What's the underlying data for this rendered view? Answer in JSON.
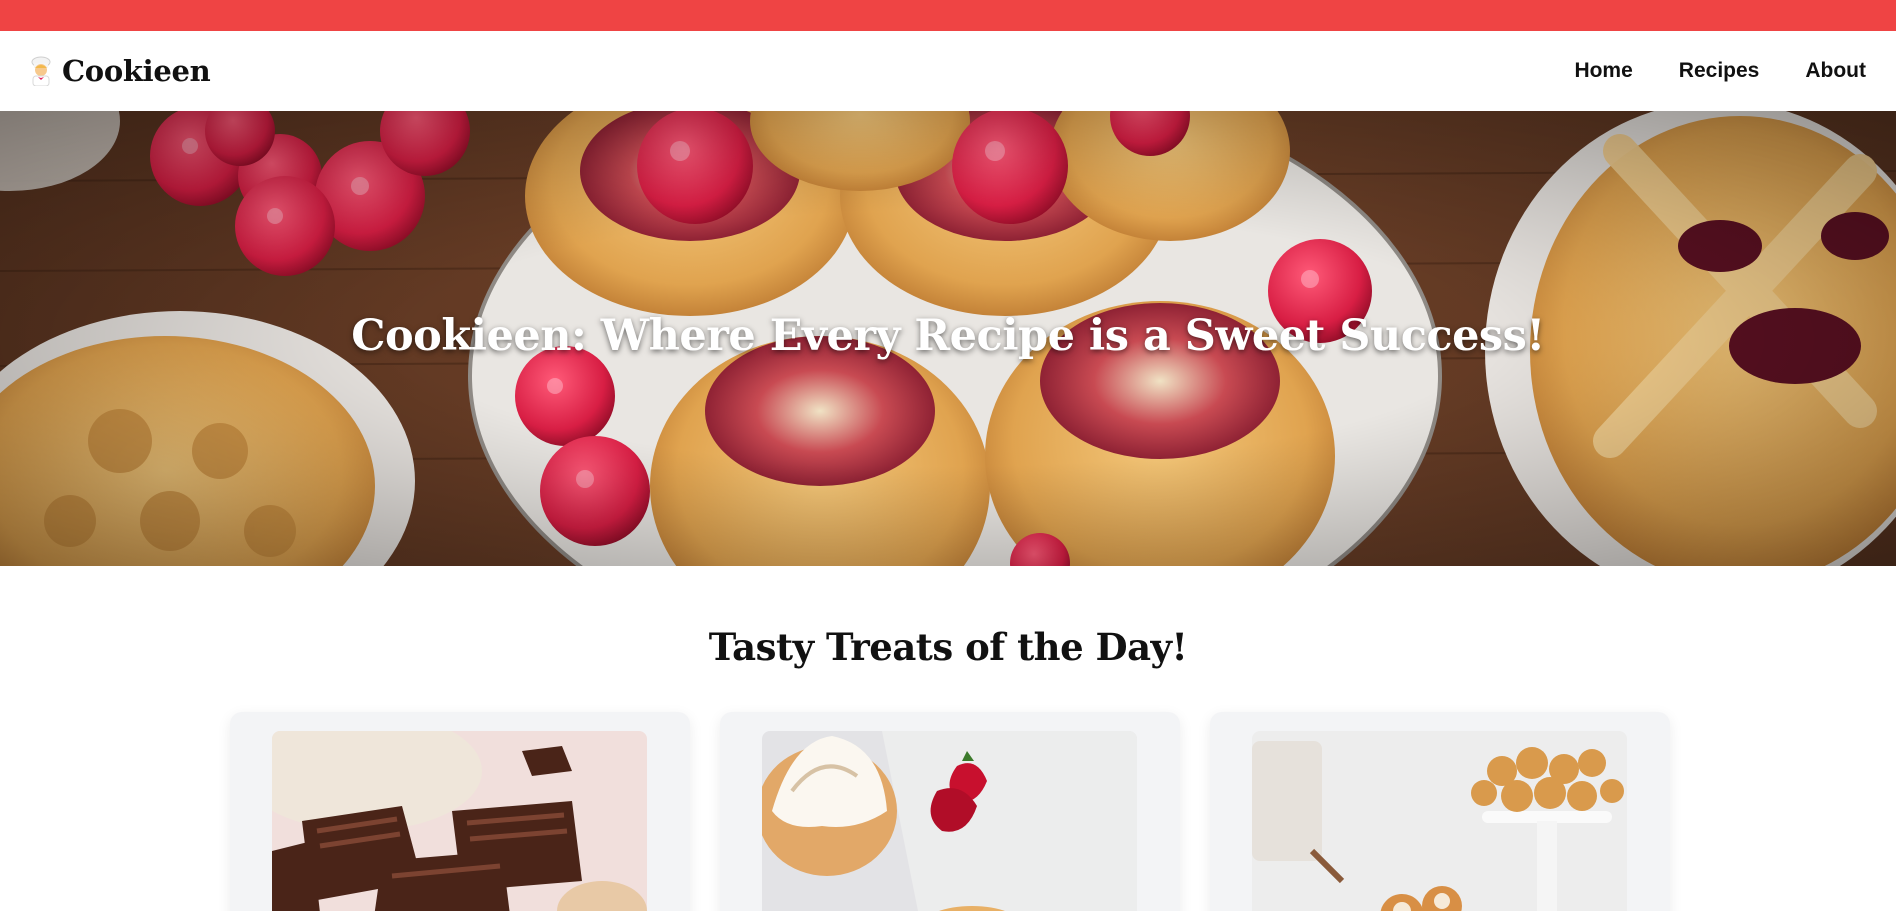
{
  "brand": {
    "name": "Cookieen",
    "icon": "chef-emoji-icon"
  },
  "nav": {
    "items": [
      {
        "label": "Home"
      },
      {
        "label": "Recipes"
      },
      {
        "label": "About"
      }
    ]
  },
  "hero": {
    "title": "Cookieen: Where Every Recipe is a Sweet Success!"
  },
  "section": {
    "title": "Tasty Treats of the Day!"
  },
  "colors": {
    "accent_bar": "#ef4444",
    "card_bg": "#f3f4f6"
  },
  "cards": [
    {
      "image": "chocolate-brownies-image"
    },
    {
      "image": "meringue-tart-strawberry-image"
    },
    {
      "image": "mini-donuts-image"
    }
  ]
}
